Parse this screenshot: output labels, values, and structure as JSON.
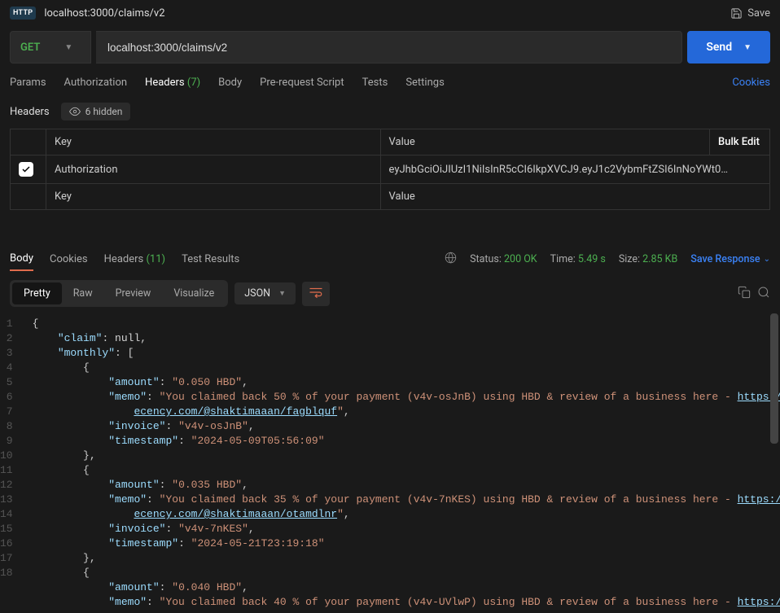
{
  "top": {
    "title_method": "HTTP",
    "title": "localhost:3000/claims/v2",
    "save": "Save"
  },
  "request": {
    "method": "GET",
    "url": "localhost:3000/claims/v2",
    "send": "Send"
  },
  "tabs": {
    "params": "Params",
    "auth": "Authorization",
    "headers": "Headers",
    "headers_count": "(7)",
    "body": "Body",
    "prereq": "Pre-request Script",
    "tests": "Tests",
    "settings": "Settings",
    "cookies": "Cookies"
  },
  "headers_section": {
    "title": "Headers",
    "hidden": "6 hidden",
    "col_key": "Key",
    "col_value": "Value",
    "bulk": "Bulk Edit",
    "row_key": "Authorization",
    "row_val": "eyJhbGciOiJIUzI1NiIsInR5cCI6IkpXVCJ9.eyJ1c2VybmFtZSI6InNoYWt0…",
    "ph_key": "Key",
    "ph_value": "Value"
  },
  "response_tabs": {
    "body": "Body",
    "cookies": "Cookies",
    "headers": "Headers",
    "headers_count": "(11)",
    "tests": "Test Results"
  },
  "meta": {
    "status_label": "Status:",
    "status_val": "200 OK",
    "time_label": "Time:",
    "time_val": "5.49 s",
    "size_label": "Size:",
    "size_val": "2.85 KB",
    "save_resp": "Save Response"
  },
  "view": {
    "pretty": "Pretty",
    "raw": "Raw",
    "preview": "Preview",
    "visualize": "Visualize",
    "format": "JSON"
  },
  "json_body": {
    "claim": null,
    "monthly": [
      {
        "amount": "0.050 HBD",
        "memo": "You claimed back 50 % of your payment (v4v-osJnB) using HBD & review of a business here - https://ecency.com/@shaktimaaan/fagblquf",
        "memo_text": "You claimed back 50 % of your payment (v4v-osJnB) using HBD & review of a business here - ",
        "memo_url": "https://ecency.com/@shaktimaaan/fagblquf",
        "invoice": "v4v-osJnB",
        "timestamp": "2024-05-09T05:56:09"
      },
      {
        "amount": "0.035 HBD",
        "memo": "You claimed back 35 % of your payment (v4v-7nKES) using HBD & review of a business here - https://ecency.com/@shaktimaaan/otamdlnr",
        "memo_text": "You claimed back 35 % of your payment (v4v-7nKES) using HBD & review of a business here - ",
        "memo_url": "https://ecency.com/@shaktimaaan/otamdlnr",
        "invoice": "v4v-7nKES",
        "timestamp": "2024-05-21T23:19:18"
      },
      {
        "amount": "0.040 HBD",
        "memo": "You claimed back 40 % of your payment (v4v-UVlwP) using HBD & review of a business here - https://",
        "memo_text": "You claimed back 40 % of your payment (v4v-UVlwP) using HBD & review of a business here - ",
        "memo_url": "https://"
      }
    ]
  }
}
